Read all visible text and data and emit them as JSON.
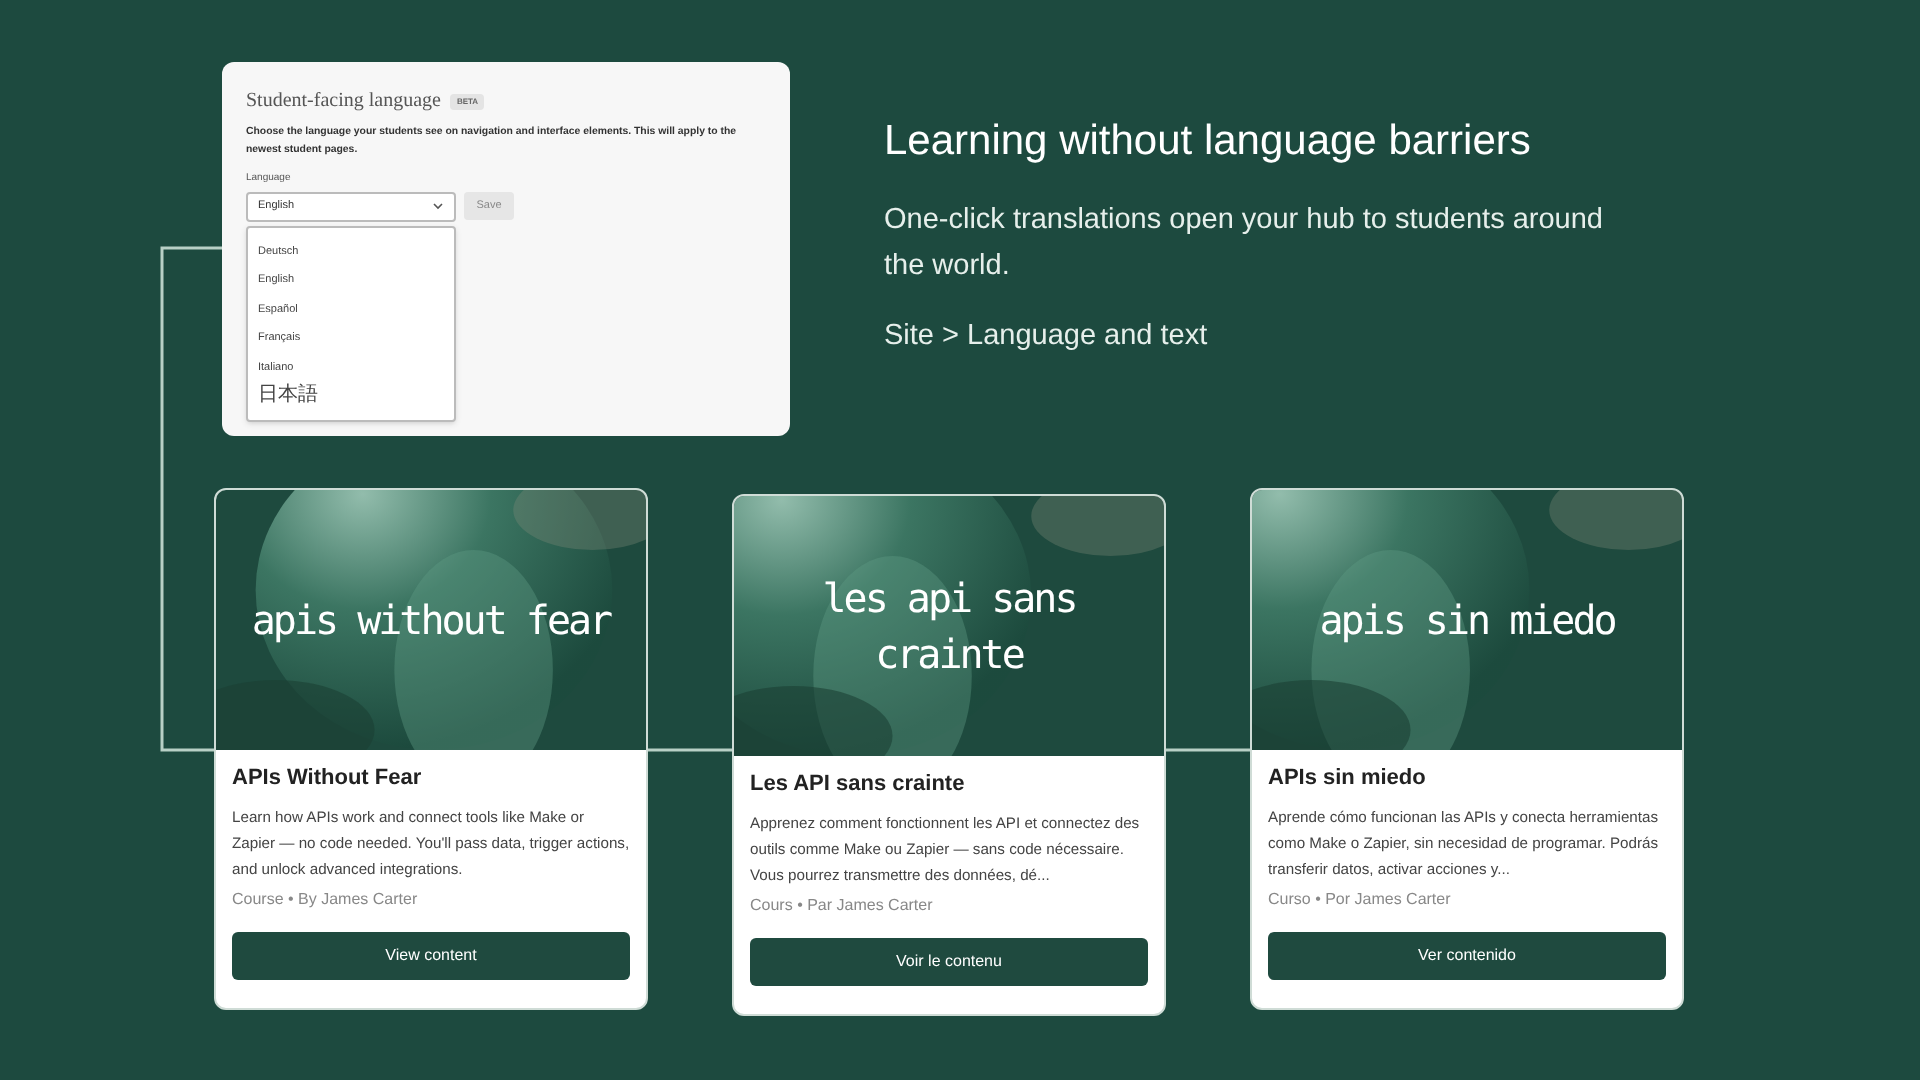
{
  "settings_panel": {
    "title": "Student-facing language",
    "badge": "BETA",
    "description": "Choose the language your students see on navigation and interface elements. This will apply to the newest student pages.",
    "field_label": "Language",
    "value": "English",
    "save_button": {
      "label": "Save",
      "disabled": true
    },
    "options": [
      {
        "label": "Deutsch",
        "kind": "latin"
      },
      {
        "label": "English",
        "kind": "latin"
      },
      {
        "label": "Español",
        "kind": "latin"
      },
      {
        "label": "Français",
        "kind": "latin"
      },
      {
        "label": "Italiano",
        "kind": "latin"
      },
      {
        "label": "日本語",
        "kind": "cjk"
      }
    ]
  },
  "headline": "Learning without language barriers",
  "subtitle": "One-click translations open your hub to students around the world.",
  "path": "Site > Language and text",
  "cards": [
    {
      "cover_text": "apis without fear",
      "title": "APIs Without Fear",
      "description": "Learn how APIs work and connect tools like Make or Zapier — no code needed. You'll pass data, trigger actions, and unlock advanced integrations.",
      "meta": "Course • By James Carter",
      "button": "View content"
    },
    {
      "cover_text": "les api sans crainte",
      "title": "Les API sans crainte",
      "description": "Apprenez comment fonctionnent les API et connectez des outils comme Make ou Zapier — sans code nécessaire. Vous pourrez transmettre des données, dé...",
      "meta": "Cours • Par James Carter",
      "button": "Voir le contenu"
    },
    {
      "cover_text": "apis sin miedo",
      "title": "APIs sin miedo",
      "description": "Aprende cómo funcionan las APIs y conecta herramientas como Make o Zapier, sin necesidad de programar. Podrás transferir datos, activar acciones y...",
      "meta": "Curso • Por James Carter",
      "button": "Ver contenido"
    }
  ]
}
